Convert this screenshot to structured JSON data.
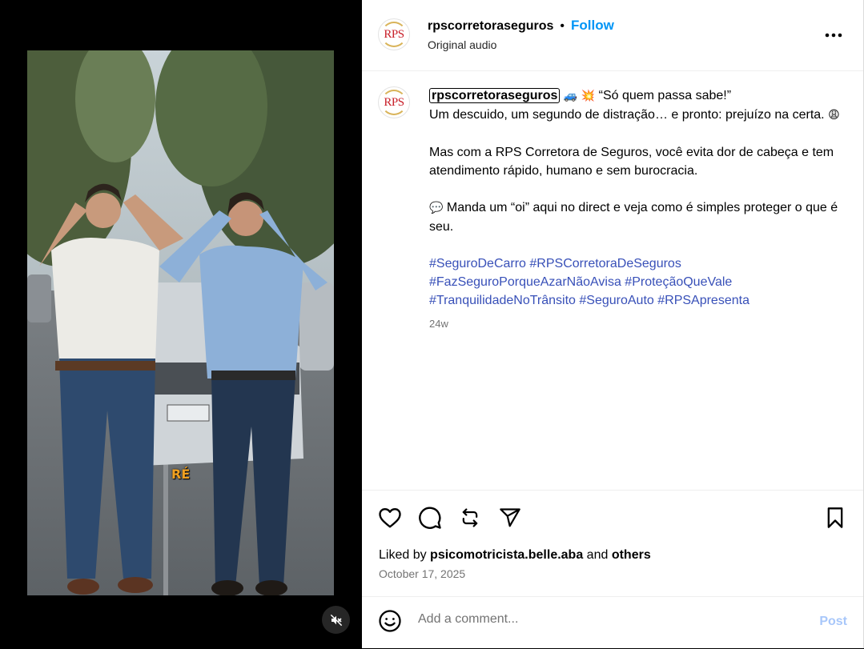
{
  "media": {
    "overlay_text": "RÉ",
    "mute_icon": "speaker-muted-icon"
  },
  "header": {
    "username": "rpscorretoraseguros",
    "separator": "•",
    "follow_label": "Follow",
    "audio_label": "Original audio",
    "logo_text": "RPS",
    "more_icon": "more-horizontal-icon"
  },
  "caption": {
    "username": "rpscorretoraseguros",
    "emoji_1": "🚙",
    "emoji_2": "💥",
    "line1_text": " “Só quem passa sabe!”",
    "line2_text": "Um descuido, um segundo de distração… e pronto: prejuízo na certa. ",
    "line2_emoji": "😩",
    "para2": "Mas com a RPS Corretora de Seguros, você evita dor de cabeça e tem atendimento rápido, humano e sem burocracia.",
    "para3_emoji": "💬",
    "para3_text": " Manda um “oi” aqui no direct e veja como é simples proteger o que é seu.",
    "hashtags": [
      "#SeguroDeCarro",
      "#RPSCorretoraDeSeguros",
      "#FazSeguroPorqueAzarNãoAvisa",
      "#ProteçãoQueVale",
      "#TranquilidadeNoTrânsito",
      "#SeguroAuto",
      "#RPSApresenta"
    ],
    "age": "24w"
  },
  "actions": {
    "like_icon": "heart-icon",
    "comment_icon": "comment-icon",
    "repost_icon": "repost-icon",
    "share_icon": "share-icon",
    "save_icon": "bookmark-icon",
    "liked_prefix": "Liked by ",
    "liked_user": "psicomotricista.belle.aba",
    "liked_and": " and ",
    "liked_others": "others",
    "date": "October 17, 2025"
  },
  "comment": {
    "emoji_icon": "smiley-icon",
    "placeholder": "Add a comment...",
    "post_label": "Post"
  },
  "colors": {
    "link_blue": "#0095f6",
    "hashtag": "#3850b8",
    "muted": "#737373",
    "post_disabled": "#a8c7fa"
  }
}
